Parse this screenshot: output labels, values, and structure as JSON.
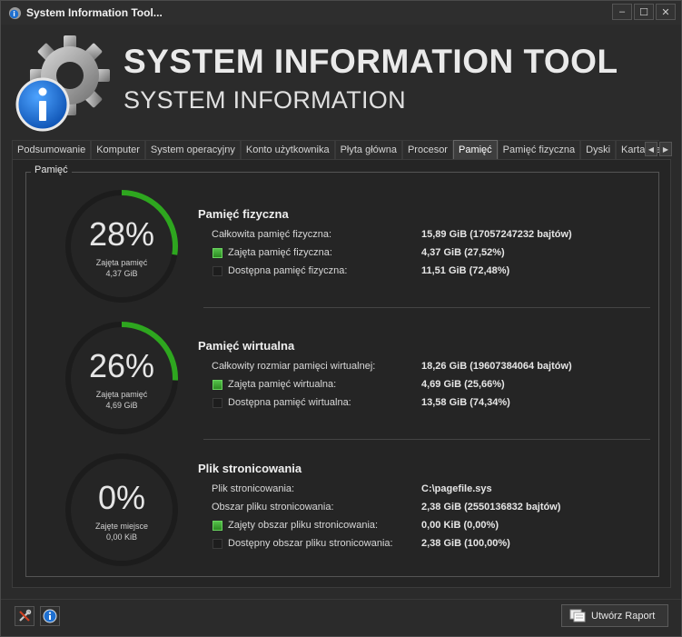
{
  "window": {
    "title": "System Information Tool...",
    "controls": [
      "–",
      "☐",
      "✕"
    ]
  },
  "header": {
    "title": "SYSTEM INFORMATION TOOL",
    "subtitle": "SYSTEM INFORMATION"
  },
  "tabs": [
    {
      "label": "Podsumowanie",
      "active": false
    },
    {
      "label": "Komputer",
      "active": false
    },
    {
      "label": "System operacyjny",
      "active": false
    },
    {
      "label": "Konto użytkownika",
      "active": false
    },
    {
      "label": "Płyta główna",
      "active": false
    },
    {
      "label": "Procesor",
      "active": false
    },
    {
      "label": "Pamięć",
      "active": true
    },
    {
      "label": "Pamięć fizyczna",
      "active": false
    },
    {
      "label": "Dyski",
      "active": false
    },
    {
      "label": "Karta sie",
      "active": false
    }
  ],
  "group_label": "Pamięć",
  "colors": {
    "accent": "#2ea61f",
    "ring_bg": "#1c1c1c",
    "bg": "#252525"
  },
  "sections": [
    {
      "title": "Pamięć fizyczna",
      "gauge": {
        "percent_text": "28%",
        "fraction": 0.2752,
        "label": "Zajęta pamięć",
        "value": "4,37 GiB"
      },
      "rows": [
        {
          "label": "Całkowita pamięć fizyczna:",
          "value": "15,89 GiB (17057247232 bajtów)",
          "indicator": "none"
        },
        {
          "label": "Zajęta pamięć fizyczna:",
          "value": "4,37 GiB (27,52%)",
          "indicator": "green"
        },
        {
          "label": "Dostępna pamięć fizyczna:",
          "value": "11,51 GiB (72,48%)",
          "indicator": "dark"
        }
      ]
    },
    {
      "title": "Pamięć wirtualna",
      "gauge": {
        "percent_text": "26%",
        "fraction": 0.2566,
        "label": "Zajęta pamięć",
        "value": "4,69 GiB"
      },
      "rows": [
        {
          "label": "Całkowity rozmiar pamięci wirtualnej:",
          "value": "18,26 GiB (19607384064 bajtów)",
          "indicator": "none"
        },
        {
          "label": "Zajęta pamięć wirtualna:",
          "value": "4,69 GiB (25,66%)",
          "indicator": "green"
        },
        {
          "label": "Dostępna pamięć wirtualna:",
          "value": "13,58 GiB (74,34%)",
          "indicator": "dark"
        }
      ]
    },
    {
      "title": "Plik stronicowania",
      "gauge": {
        "percent_text": "0%",
        "fraction": 0.0,
        "label": "Zajęte miejsce",
        "value": "0,00 KiB"
      },
      "rows": [
        {
          "label": "Plik stronicowania:",
          "value": "C:\\pagefile.sys",
          "indicator": "none"
        },
        {
          "label": "Obszar pliku stronicowania:",
          "value": "2,38 GiB (2550136832 bajtów)",
          "indicator": "none"
        },
        {
          "label": "Zajęty obszar pliku stronicowania:",
          "value": "0,00 KiB (0,00%)",
          "indicator": "green"
        },
        {
          "label": "Dostępny obszar pliku stronicowania:",
          "value": "2,38 GiB (100,00%)",
          "indicator": "dark"
        }
      ]
    }
  ],
  "footer": {
    "report_button": "Utwórz Raport",
    "tool_icons": [
      "tools-icon",
      "info-icon"
    ]
  }
}
